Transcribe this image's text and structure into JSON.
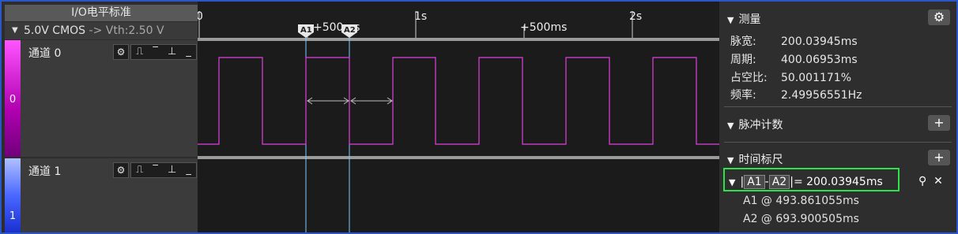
{
  "io_standard": {
    "header": "I/O电平标准",
    "voltage": "5.0V CMOS",
    "threshold": "-> Vth:2.50 V"
  },
  "channels": [
    {
      "index": "0",
      "name": "通道 0",
      "color": "#e040e0"
    },
    {
      "index": "1",
      "name": "通道 1",
      "color": "#3850ff"
    }
  ],
  "channel_tools": {
    "settings_icon": "gear-icon",
    "trigger_icons": [
      "rising-edge-icon",
      "high-level-icon",
      "falling-edge-icon",
      "low-level-icon"
    ]
  },
  "timeline": {
    "ticks": [
      {
        "label": "0"
      },
      {
        "label": "+500ms"
      },
      {
        "label": "1s"
      },
      {
        "label": "+500ms"
      },
      {
        "label": "2s"
      }
    ]
  },
  "markers": [
    {
      "label": "A1",
      "time_ms": 493.861055
    },
    {
      "label": "A2",
      "time_ms": 693.900505
    }
  ],
  "measurements": {
    "title": "测量",
    "items": [
      {
        "label": "脉宽:",
        "value": "200.03945ms"
      },
      {
        "label": "周期:",
        "value": "400.06953ms"
      },
      {
        "label": "占空比:",
        "value": "50.001171%"
      },
      {
        "label": "频率:",
        "value": "2.49956551Hz"
      }
    ]
  },
  "pulse_count": {
    "title": "脉冲计数"
  },
  "time_ruler": {
    "title": "时间标尺",
    "a1": "A1",
    "a2": "A2",
    "sep": "-",
    "result": "= 200.03945ms",
    "a1_line": "A1 @ 493.861055ms",
    "a2_line": "A2 @ 693.900505ms"
  },
  "colors": {
    "accent_green": "#2ee34a",
    "border_blue": "#2a57c8",
    "marker_line": "#7ec8ff"
  }
}
